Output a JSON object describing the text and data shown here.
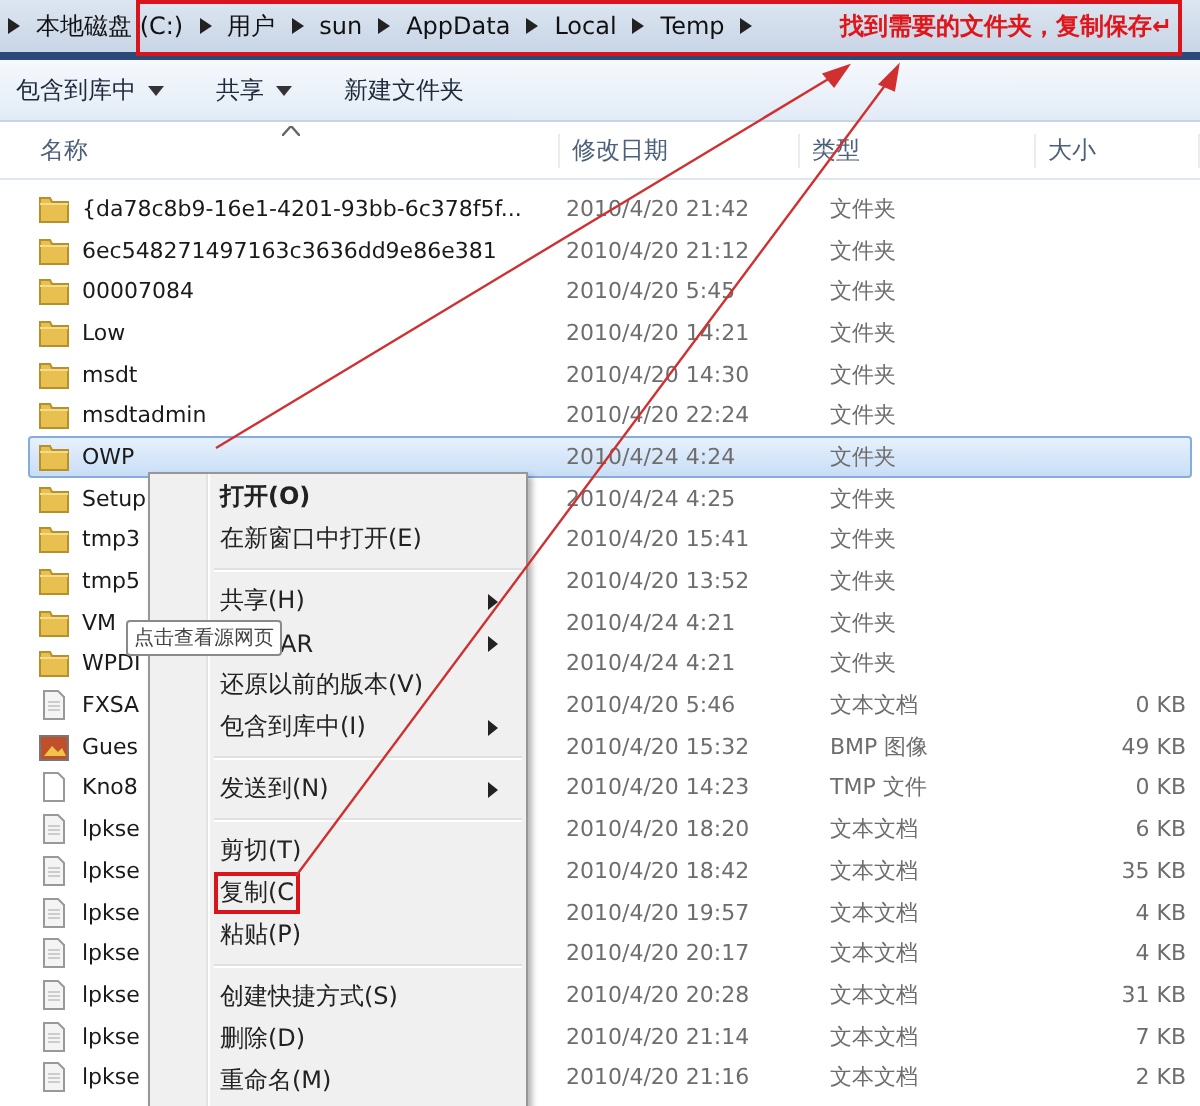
{
  "address_bar": {
    "crumbs": [
      "本地磁盘 (C:)",
      "用户",
      "sun",
      "AppData",
      "Local",
      "Temp"
    ]
  },
  "annotation": {
    "text": "找到需要的文件夹，复制保存↵"
  },
  "toolbar": {
    "buttons": [
      {
        "label": "包含到库中",
        "dropdown": true
      },
      {
        "label": "共享",
        "dropdown": true
      },
      {
        "label": "新建文件夹",
        "dropdown": false
      }
    ]
  },
  "table": {
    "columns": [
      "名称",
      "修改日期",
      "类型",
      "大小"
    ],
    "rows": [
      {
        "kind": "folder",
        "name": "{da78c8b9-16e1-4201-93bb-6c378f5f...",
        "date": "2010/4/20 21:42",
        "type": "文件夹",
        "selected": false
      },
      {
        "kind": "folder",
        "name": "6ec548271497163c3636dd9e86e381",
        "date": "2010/4/20 21:12",
        "type": "文件夹",
        "selected": false
      },
      {
        "kind": "folder",
        "name": "00007084",
        "date": "2010/4/20 5:45",
        "type": "文件夹",
        "selected": false
      },
      {
        "kind": "folder",
        "name": "Low",
        "date": "2010/4/20 14:21",
        "type": "文件夹",
        "selected": false
      },
      {
        "kind": "folder",
        "name": "msdt",
        "date": "2010/4/20 14:30",
        "type": "文件夹",
        "selected": false
      },
      {
        "kind": "folder",
        "name": "msdtadmin",
        "date": "2010/4/20 22:24",
        "type": "文件夹",
        "selected": false
      },
      {
        "kind": "folder",
        "name": "OWP",
        "date": "2010/4/24 4:24",
        "type": "文件夹",
        "selected": true
      },
      {
        "kind": "folder",
        "name": "Setup",
        "date": "2010/4/24 4:25",
        "type": "文件夹",
        "selected": false
      },
      {
        "kind": "folder",
        "name": "tmp3",
        "date": "2010/4/20 15:41",
        "type": "文件夹",
        "selected": false
      },
      {
        "kind": "folder",
        "name": "tmp5",
        "date": "2010/4/20 13:52",
        "type": "文件夹",
        "selected": false
      },
      {
        "kind": "folder",
        "name": "VM",
        "date": "2010/4/24 4:21",
        "type": "文件夹",
        "selected": false
      },
      {
        "kind": "folder",
        "name": "WPDI",
        "date": "2010/4/24 4:21",
        "type": "文件夹",
        "selected": false
      },
      {
        "kind": "text",
        "name": "FXSA",
        "date": "2010/4/20 5:46",
        "type": "文本文档",
        "size": "0 KB",
        "selected": false
      },
      {
        "kind": "image",
        "name": "Gues",
        "date": "2010/4/20 15:32",
        "type": "BMP 图像",
        "size": "49 KB",
        "selected": false
      },
      {
        "kind": "file",
        "name": "Kno8",
        "date": "2010/4/20 14:23",
        "type": "TMP 文件",
        "size": "0 KB",
        "selected": false
      },
      {
        "kind": "text",
        "name": "lpkse",
        "date": "2010/4/20 18:20",
        "type": "文本文档",
        "size": "6 KB",
        "selected": false
      },
      {
        "kind": "text",
        "name": "lpkse",
        "date": "2010/4/20 18:42",
        "type": "文本文档",
        "size": "35 KB",
        "selected": false
      },
      {
        "kind": "text",
        "name": "lpkse",
        "date": "2010/4/20 19:57",
        "type": "文本文档",
        "size": "4 KB",
        "selected": false
      },
      {
        "kind": "text",
        "name": "lpkse",
        "date": "2010/4/20 20:17",
        "type": "文本文档",
        "size": "4 KB",
        "selected": false
      },
      {
        "kind": "text",
        "name": "lpkse",
        "date": "2010/4/20 20:28",
        "type": "文本文档",
        "size": "31 KB",
        "selected": false
      },
      {
        "kind": "text",
        "name": "lpkse",
        "date": "2010/4/20 21:14",
        "type": "文本文档",
        "size": "7 KB",
        "selected": false
      },
      {
        "kind": "text",
        "name": "lpkse",
        "date": "2010/4/20 21:16",
        "type": "文本文档",
        "size": "2 KB",
        "selected": false
      }
    ]
  },
  "context_menu": {
    "items": [
      {
        "kind": "item",
        "label": "打开(O)",
        "default": true,
        "submenu": false,
        "highlighted": false
      },
      {
        "kind": "item",
        "label": "在新窗口中打开(E)",
        "default": false,
        "submenu": false,
        "highlighted": false
      },
      {
        "kind": "separator"
      },
      {
        "kind": "item",
        "label": "共享(H)",
        "default": false,
        "submenu": true,
        "highlighted": false
      },
      {
        "kind": "covered",
        "label": "AR",
        "default": false,
        "submenu": true,
        "highlighted": false
      },
      {
        "kind": "item",
        "label": "还原以前的版本(V)",
        "default": false,
        "submenu": false,
        "highlighted": false
      },
      {
        "kind": "item",
        "label": "包含到库中(I)",
        "default": false,
        "submenu": true,
        "highlighted": false
      },
      {
        "kind": "separator"
      },
      {
        "kind": "item",
        "label": "发送到(N)",
        "default": false,
        "submenu": true,
        "highlighted": false
      },
      {
        "kind": "separator"
      },
      {
        "kind": "item",
        "label": "剪切(T)",
        "default": false,
        "submenu": false,
        "highlighted": false
      },
      {
        "kind": "item",
        "label": "复制(C",
        "default": false,
        "submenu": false,
        "highlighted": true
      },
      {
        "kind": "item",
        "label": "粘贴(P)",
        "default": false,
        "submenu": false,
        "highlighted": false
      },
      {
        "kind": "separator"
      },
      {
        "kind": "item",
        "label": "创建快捷方式(S)",
        "default": false,
        "submenu": false,
        "highlighted": false
      },
      {
        "kind": "item",
        "label": "删除(D)",
        "default": false,
        "submenu": false,
        "highlighted": false
      },
      {
        "kind": "item",
        "label": "重命名(M)",
        "default": false,
        "submenu": false,
        "highlighted": false
      }
    ]
  },
  "tooltip": {
    "text": "点击查看源网页"
  }
}
